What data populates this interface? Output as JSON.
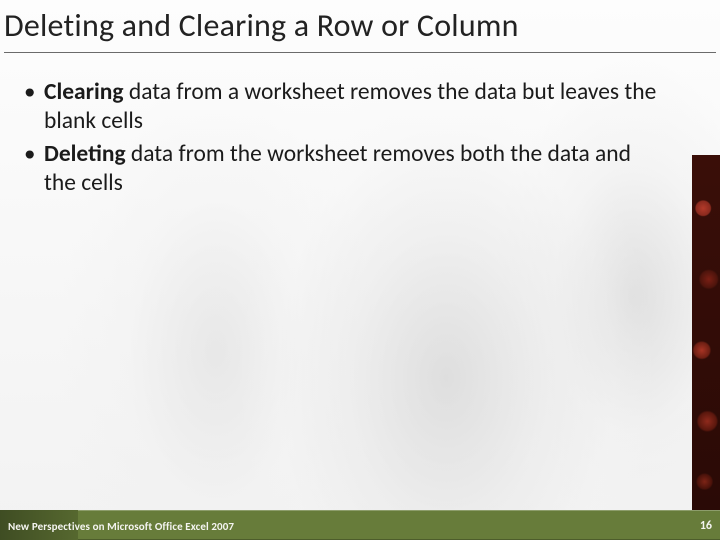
{
  "title": "Deleting and Clearing a Row or Column",
  "bullets": [
    {
      "bold": "Clearing",
      "rest": " data from a worksheet removes the data but leaves the blank cells"
    },
    {
      "bold": "Deleting",
      "rest": " data from the worksheet removes both the data and the cells"
    }
  ],
  "footer": "New Perspectives on Microsoft Office Excel 2007",
  "page": "16"
}
